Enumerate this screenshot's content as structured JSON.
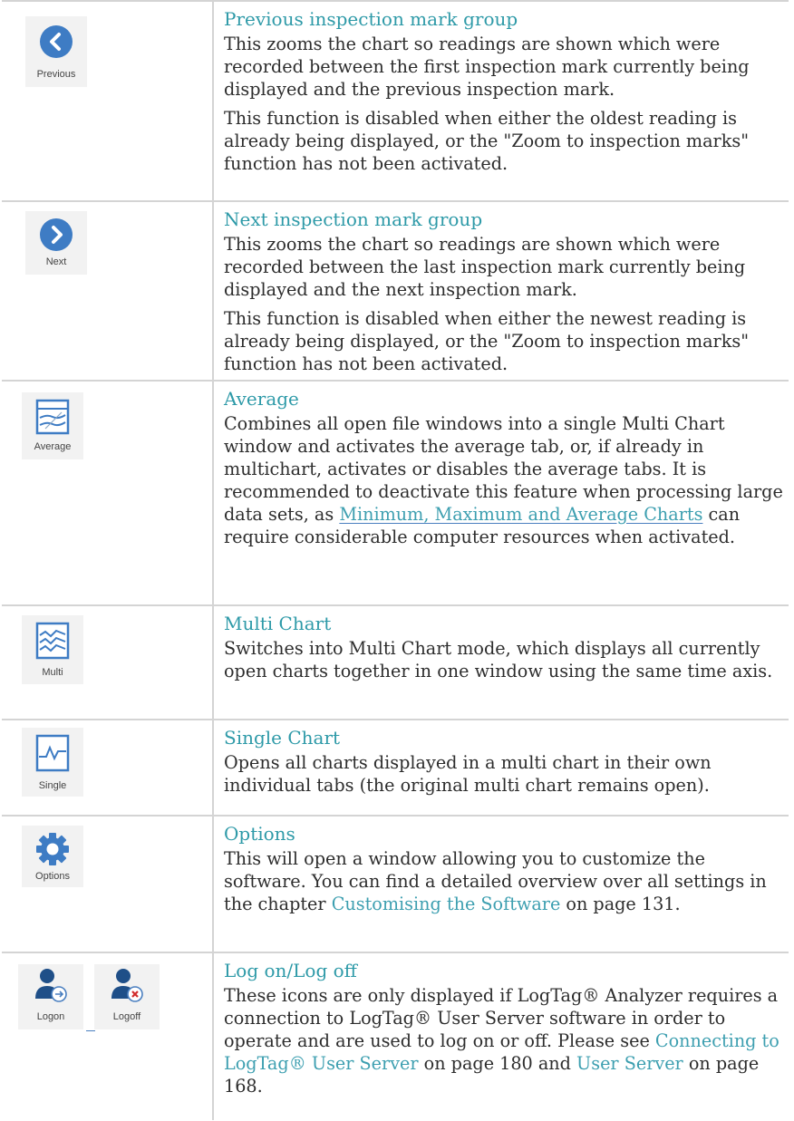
{
  "rows": [
    {
      "icon_labels": [
        "Previous"
      ],
      "icons": [
        "previous-circle-icon"
      ],
      "title": "Previous inspection mark group",
      "paragraphs": [
        "This zooms the chart so readings are shown which were recorded between the first inspection mark currently being displayed and the previous inspection mark.",
        "This function is disabled when either the oldest reading is already being displayed, or the \"Zoom to inspection marks\" function has not been activated."
      ]
    },
    {
      "icon_labels": [
        "Next"
      ],
      "icons": [
        "next-circle-icon"
      ],
      "title": "Next inspection mark group",
      "paragraphs": [
        "This zooms the chart so readings are shown which were recorded between the last inspection mark currently being displayed and the next inspection mark.",
        "This function is disabled when either the newest reading is already being displayed, or the \"Zoom to inspection marks\" function has not been activated."
      ]
    },
    {
      "icon_labels": [
        "Average"
      ],
      "icons": [
        "average-chart-icon"
      ],
      "title": "Average",
      "text_before_link": "Combines all open file windows into a single Multi Chart window and activates the average tab, or, if already in multichart, activates or disables the average tabs. It is recommended to deactivate this feature when processing large data sets, as ",
      "link": "Minimum, Maximum and Average Charts",
      "text_after_link": " can require considerable computer resources when activated."
    },
    {
      "icon_labels": [
        "Multi"
      ],
      "icons": [
        "multi-chart-icon"
      ],
      "title": "Multi Chart",
      "paragraphs": [
        "Switches into Multi Chart mode, which displays all currently open charts together in one window using the same time axis."
      ]
    },
    {
      "icon_labels": [
        "Single"
      ],
      "icons": [
        "single-chart-icon"
      ],
      "title": "Single Chart",
      "paragraphs": [
        "Opens all charts displayed in a multi chart in their own individual tabs (the original multi chart remains open)."
      ]
    },
    {
      "icon_labels": [
        "Options"
      ],
      "icons": [
        "gear-icon"
      ],
      "title": "Options",
      "text_before_link": "This will open a window allowing you to customize the software. You can find a detailed overview over all settings in the chapter ",
      "link": "Customising the Software",
      "text_after_link": " on page 131."
    },
    {
      "icon_labels": [
        "Logon",
        "Logoff"
      ],
      "icons": [
        "logon-user-icon",
        "logoff-user-icon"
      ],
      "title": "Log on/Log off",
      "text_1": "These icons are only displayed if LogTag® Analyzer requires a connection to LogTag® User Server software in order to operate and are used to log on or off. Please see ",
      "link_1": "Connecting to LogTag® User Server",
      "text_2": " on page 180 and ",
      "link_2": "User Server",
      "text_3": " on page 168."
    }
  ],
  "colors": {
    "title": "#2e9aa8",
    "link": "#3d9fb0",
    "icon_blue": "#3e7cc4",
    "grid": "#d4d4d4"
  }
}
